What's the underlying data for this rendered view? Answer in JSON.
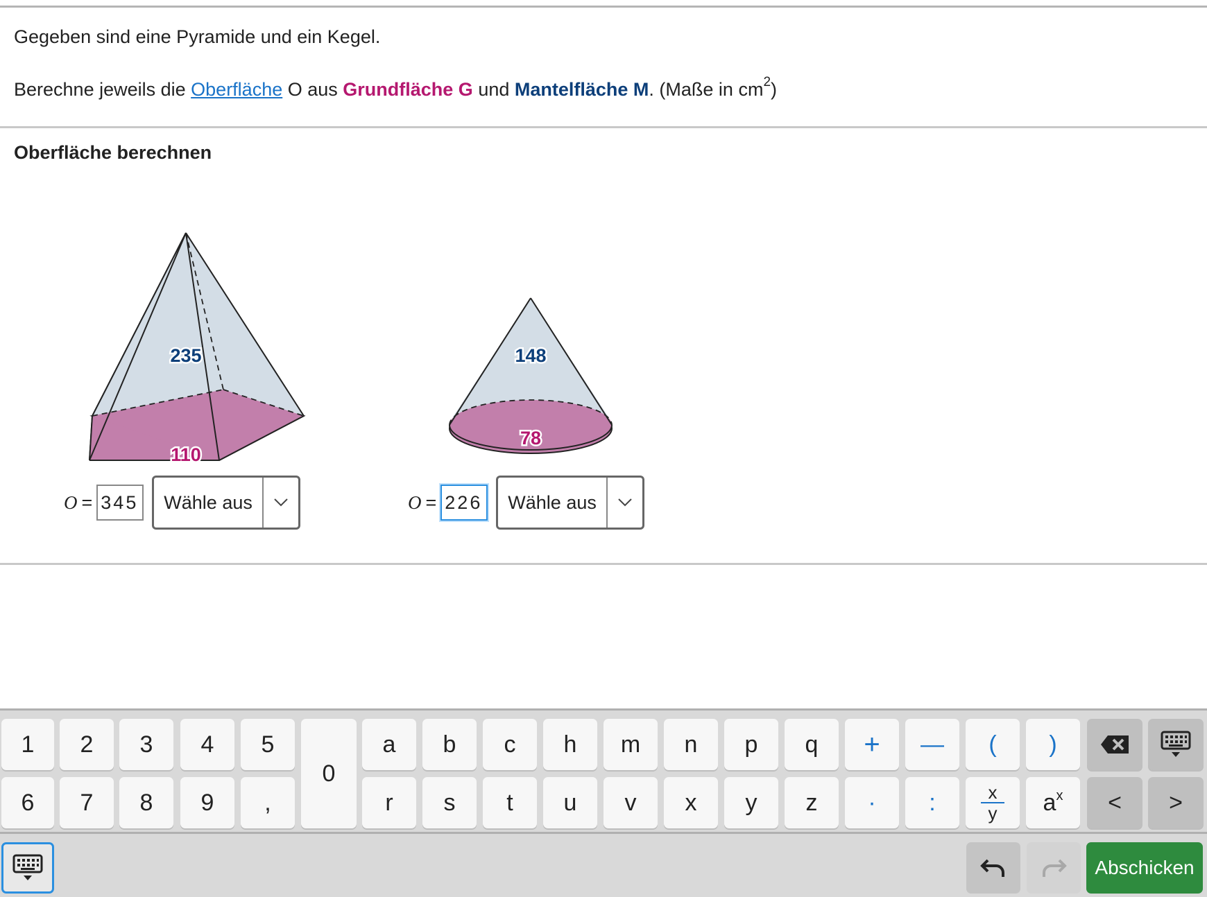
{
  "intro": "Gegeben sind eine Pyramide und ein Kegel.",
  "task": {
    "prefix": "Berechne jeweils die ",
    "link": "Oberfläche",
    "mid1": " O aus ",
    "grundflaeche": "Grundfläche G",
    "mid2": " und ",
    "mantelflaeche": "Mantelfläche M",
    "suffix": ". (Maße in cm",
    "sup": "2",
    "close": ")"
  },
  "section_title": "Oberfläche berechnen",
  "figures": {
    "pyramid": {
      "mantel": "235",
      "grund": "110"
    },
    "cone": {
      "mantel": "148",
      "grund": "78"
    }
  },
  "answers": [
    {
      "var": "O",
      "eq": "=",
      "value": "345",
      "select": "Wähle aus"
    },
    {
      "var": "O",
      "eq": "=",
      "value": "226",
      "select": "Wähle aus"
    }
  ],
  "keyboard": {
    "row1_digits": [
      "1",
      "2",
      "3",
      "4",
      "5"
    ],
    "row2_digits": [
      "6",
      "7",
      "8",
      "9",
      ","
    ],
    "zero": "0",
    "row1_letters": [
      "a",
      "b",
      "c",
      "h",
      "m",
      "n",
      "p",
      "q"
    ],
    "row2_letters": [
      "r",
      "s",
      "t",
      "u",
      "v",
      "x",
      "y",
      "z"
    ],
    "row1_ops": [
      "+",
      "—",
      "(",
      ")"
    ],
    "row2_ops": [
      "·",
      ":"
    ],
    "frac_num": "x",
    "frac_den": "y",
    "power": "a",
    "power_sup": "x",
    "left": "<",
    "right": ">",
    "submit": "Abschicken"
  },
  "colors": {
    "grund": "#b5186f",
    "mantel": "#0d3f7a",
    "submit": "#2e8b3e",
    "link": "#1a73c8"
  }
}
